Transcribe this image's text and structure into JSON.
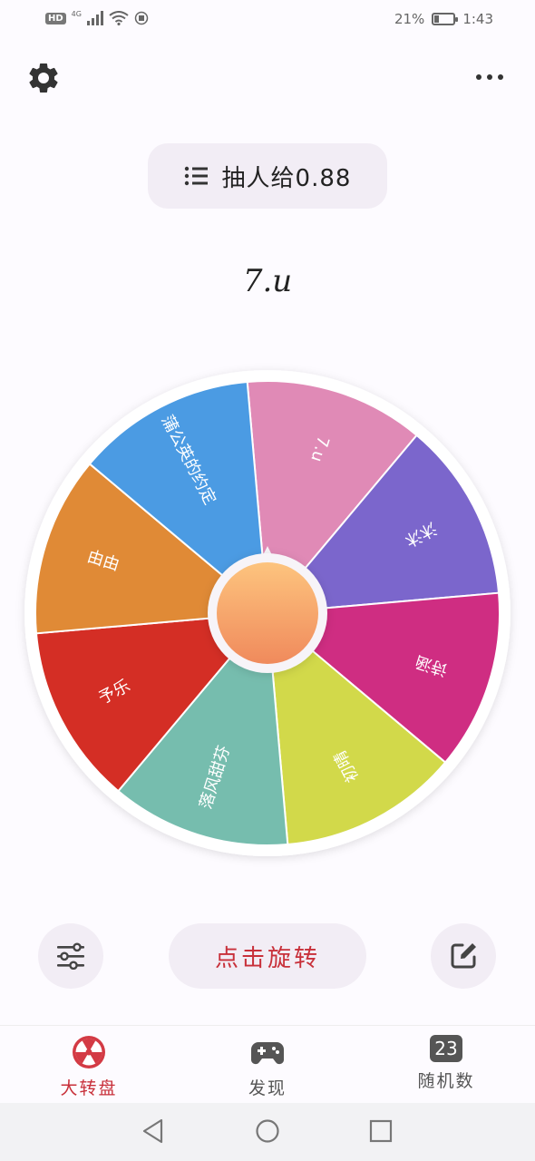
{
  "status_bar": {
    "hd": "HD",
    "network": "4G",
    "battery_text": "21%",
    "battery_level": 0.21,
    "time": "1:43"
  },
  "toolbar": {
    "settings_icon": "gear-icon",
    "more_icon": "more-horizontal-icon"
  },
  "title_pill": {
    "icon": "list-icon",
    "title": "抽人给0.88"
  },
  "result": "7.u",
  "wheel": {
    "segments": [
      {
        "label": "7.u",
        "color": "#e08ab6"
      },
      {
        "label": "沐沐",
        "color": "#7b66cc"
      },
      {
        "label": "诗涵",
        "color": "#cf2d82"
      },
      {
        "label": "初晴",
        "color": "#d2d94a"
      },
      {
        "label": "落风甜芬",
        "color": "#76bdae"
      },
      {
        "label": "予乐",
        "color": "#d42e25"
      },
      {
        "label": "由由",
        "color": "#e08a36"
      },
      {
        "label": "蒲公英的约定",
        "color": "#4b9be3"
      }
    ],
    "hub_color": "#f4a66c"
  },
  "controls": {
    "options_icon": "sliders-icon",
    "spin_label": "点击旋转",
    "edit_icon": "edit-icon"
  },
  "bottom_nav": {
    "items": [
      {
        "label": "大转盘",
        "icon": "wheel-icon",
        "active": true
      },
      {
        "label": "发现",
        "icon": "gamepad-icon",
        "active": false
      },
      {
        "label": "随机数",
        "icon": "number-icon",
        "icon_text": "23",
        "active": false
      }
    ]
  },
  "system_nav": {
    "back": "back-icon",
    "home": "home-icon",
    "recents": "recents-icon"
  }
}
